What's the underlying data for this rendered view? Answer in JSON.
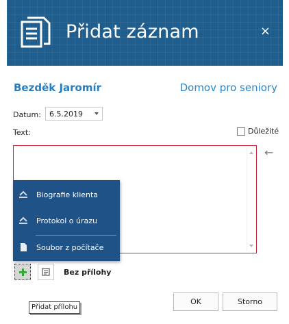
{
  "dialog": {
    "title": "Přidat záznam",
    "close_glyph": "×",
    "header_color": "#1f5d8c"
  },
  "client": {
    "name": "Bezděk Jaromír",
    "facility": "Domov pro seniory"
  },
  "form": {
    "date_label": "Datum:",
    "date_value": "6.5.2019",
    "text_label": "Text:",
    "important_label": "Důležité",
    "important_checked": false,
    "text_value": ""
  },
  "attachment_menu": {
    "items": [
      {
        "label": "Biografie klienta",
        "icon": "cloud-upload-icon"
      },
      {
        "label": "Protokol o úrazu",
        "icon": "cloud-upload-icon"
      },
      {
        "label": "Soubor z počítače",
        "icon": "file-icon"
      }
    ],
    "background": "#1f5287"
  },
  "attachments": {
    "status": "Bez přílohy",
    "add_tooltip": "Přidat přílohu"
  },
  "buttons": {
    "ok": "OK",
    "cancel": "Storno"
  },
  "colors": {
    "accent": "#2a7ebd",
    "error_border": "#c8283a",
    "add_icon": "#3aa53a"
  }
}
